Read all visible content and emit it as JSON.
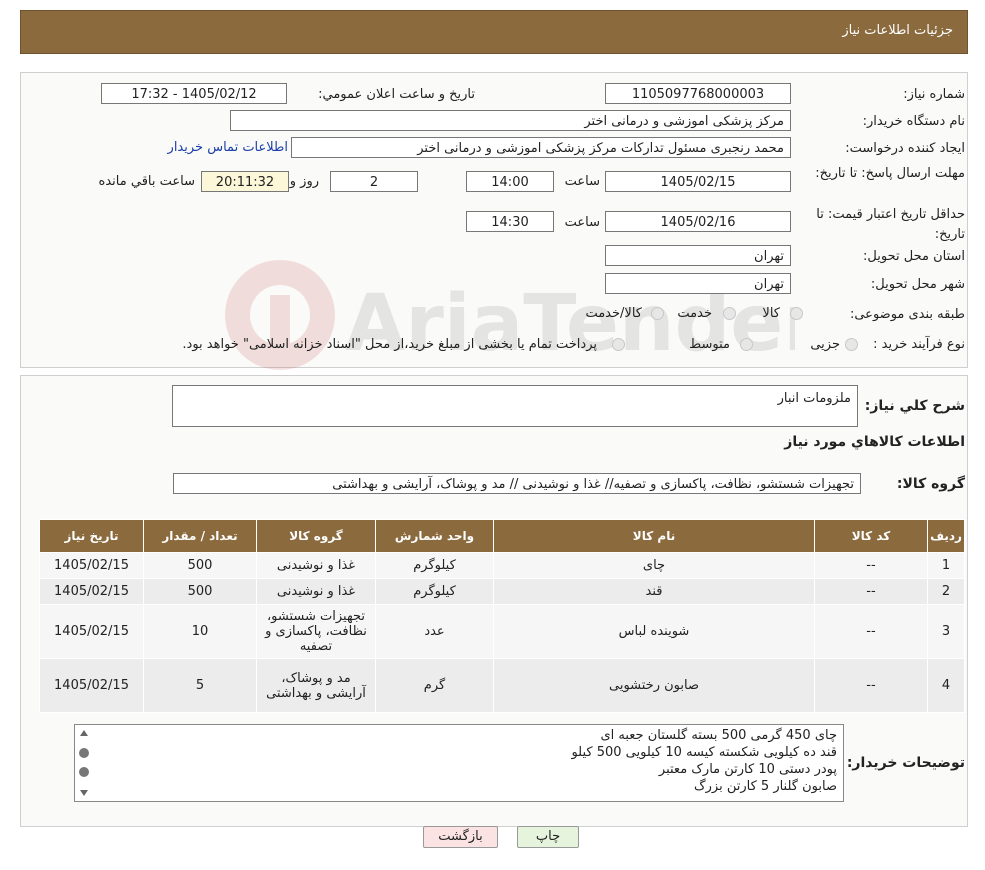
{
  "header": {
    "title": "جزئیات اطلاعات نیاز"
  },
  "form": {
    "need_number_label": "شماره نیاز:",
    "need_number": "1105097768000003",
    "announce_label": "تاریخ و ساعت اعلان عمومي:",
    "announce_value": "1405/02/12 - 17:32",
    "buyer_org_label": "نام دستگاه خریدار:",
    "buyer_org": "مرکز پزشکی  اموزشی و درمانی اختر",
    "requester_label": "ایجاد کننده درخواست:",
    "requester": "محمد رنجبری مسئول تدارکات مرکز پزشکی  اموزشی و درمانی اختر",
    "contact_link": "اطلاعات تماس خریدار",
    "deadline_label": "مهلت ارسال پاسخ: تا تاریخ:",
    "deadline_date": "1405/02/15",
    "time_label": "ساعت",
    "deadline_time": "14:00",
    "days_count": "2",
    "days_label": "روز و",
    "remaining_time": "20:11:32",
    "remaining_label": "ساعت باقي مانده",
    "validity_label": "حداقل تاریخ اعتبار قیمت: تا تاریخ:",
    "validity_date": "1405/02/16",
    "validity_time": "14:30",
    "province_label": "استان محل تحویل:",
    "province": "تهران",
    "city_label": "شهر محل تحویل:",
    "city": "تهران",
    "category_label": "طبقه بندی موضوعی:",
    "category_options": [
      "کالا",
      "خدمت",
      "کالا/خدمت"
    ],
    "process_label": "نوع فرآیند خرید :",
    "process_options": [
      "جزیی",
      "متوسط"
    ],
    "process_note": "پرداخت تمام یا بخشی از مبلغ خرید،از محل \"اسناد خزانه اسلامی\" خواهد بود."
  },
  "watermark": "AriaTender.neT",
  "summary": {
    "desc_label": "شرح کلي نیاز:",
    "desc_value": "ملزومات انبار",
    "items_title": "اطلاعات کالاهاي مورد نیاز",
    "group_label": "گروه کالا:",
    "group_value": "تجهیزات شستشو، نظافت، پاکسازی و تصفیه// غذا و نوشیدنی // مد و پوشاک، آرایشی و بهداشتی"
  },
  "table": {
    "headers": [
      "ردیف",
      "کد کالا",
      "نام کالا",
      "واحد شمارش",
      "گروه کالا",
      "تعداد / مقدار",
      "تاریخ نیاز"
    ],
    "rows": [
      [
        "1",
        "--",
        "چای",
        "کیلوگرم",
        "غذا و نوشیدنی",
        "500",
        "1405/02/15"
      ],
      [
        "2",
        "--",
        "قند",
        "کیلوگرم",
        "غذا و نوشیدنی",
        "500",
        "1405/02/15"
      ],
      [
        "3",
        "--",
        "شوینده لباس",
        "عدد",
        "تجهیزات شستشو، نظافت، پاکسازی و تصفیه",
        "10",
        "1405/02/15"
      ],
      [
        "4",
        "--",
        "صابون رختشویی",
        "گرم",
        "مد و پوشاک، آرایشی و بهداشتی",
        "5",
        "1405/02/15"
      ]
    ]
  },
  "notes": {
    "label": "توضیحات خریدار:",
    "lines": [
      "چای 450 گرمی 500 بسته گلستان جعبه ای",
      "قند ده کیلویی شکسته کیسه 10 کیلویی 500 کیلو",
      "پودر دستی 10 کارتن مارک معتبر",
      "صابون گلنار 5 کارتن بزرگ"
    ]
  },
  "buttons": {
    "print": "چاپ",
    "back": "بازگشت"
  },
  "colors": {
    "header_bg": "#8b6a3e",
    "link": "#1a3faa",
    "back_bg": "#fbe3e3",
    "print_bg": "#e6f3dd"
  }
}
